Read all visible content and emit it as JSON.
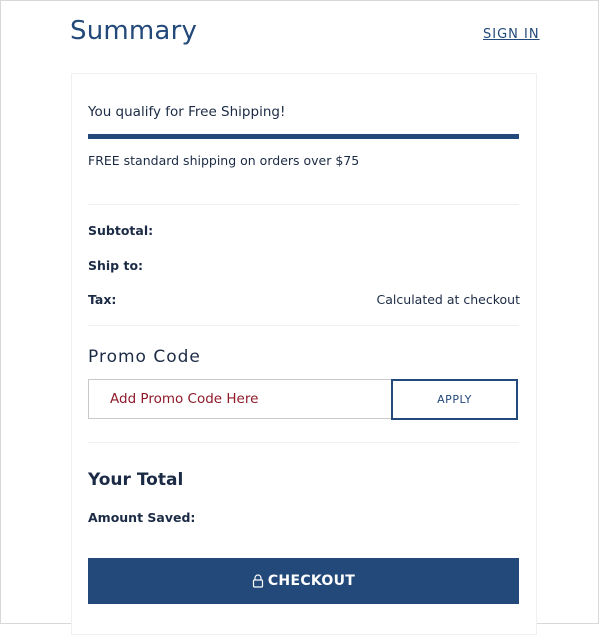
{
  "header": {
    "title": "Summary",
    "sign_in_label": "SIGN IN"
  },
  "shipping": {
    "qualify_text": "You qualify for Free Shipping!",
    "progress_percent": 100,
    "free_note": "FREE standard shipping on orders over $75"
  },
  "summary_rows": {
    "subtotal_label": "Subtotal:",
    "subtotal_value": "",
    "ship_to_label": "Ship to:",
    "ship_to_value": "",
    "tax_label": "Tax:",
    "tax_value": "Calculated at checkout"
  },
  "promo": {
    "heading": "Promo Code",
    "placeholder": "Add Promo Code Here",
    "value": "",
    "apply_label": "APPLY"
  },
  "total": {
    "heading": "Your Total",
    "amount_saved_label": "Amount Saved:",
    "amount_saved_value": ""
  },
  "checkout": {
    "label": "CHECKOUT",
    "icon": "lock-icon"
  },
  "colors": {
    "brand": "#23497a",
    "text": "#1c2b45",
    "promo_placeholder": "#8e1a2a"
  }
}
